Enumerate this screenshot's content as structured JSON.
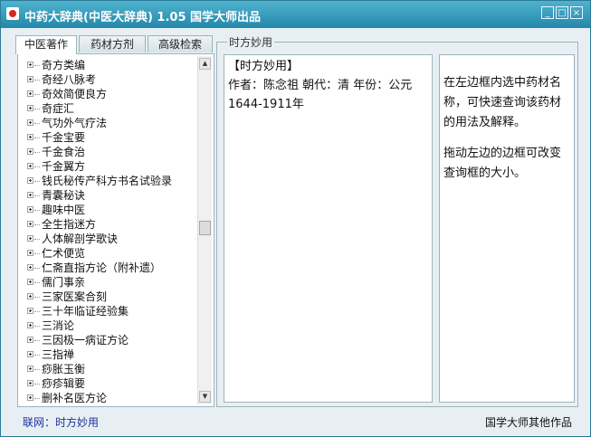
{
  "window": {
    "title": "中药大辞典(中医大辞典) 1.05   国学大师出品",
    "controls": {
      "minimize": "_",
      "maximize": "□",
      "close": "×"
    }
  },
  "tabs": [
    {
      "label": "中医著作",
      "active": true
    },
    {
      "label": "药材方剂",
      "active": false
    },
    {
      "label": "高级检索",
      "active": false
    }
  ],
  "tree": {
    "items": [
      "奇方类编",
      "奇经八脉考",
      "奇效简便良方",
      "奇症汇",
      "气功外气疗法",
      "千金宝要",
      "千金食治",
      "千金翼方",
      "钱氏秘传产科方书名试验录",
      "青囊秘诀",
      "趣味中医",
      "全生指迷方",
      "人体解剖学歌诀",
      "仁术便览",
      "仁斋直指方论（附补遗）",
      "儒门事亲",
      "三家医案合刻",
      "三十年临证经验集",
      "三消论",
      "三因极一病证方论",
      "三指禅",
      "痧胀玉衡",
      "痧疹辑要",
      "删补名医方论"
    ]
  },
  "detail": {
    "group_label": "时方妙用",
    "heading": "【时方妙用】",
    "meta": "作者：陈念祖 朝代：清 年份：公元1644-1911年"
  },
  "hint": {
    "lines": [
      "在左边框内选中药材名称，可快速查询该药材的用法及解释。",
      "拖动左边的边框可改变查询框的大小。"
    ]
  },
  "status": {
    "link": "联网：时方妙用",
    "credit": "国学大师其他作品"
  }
}
